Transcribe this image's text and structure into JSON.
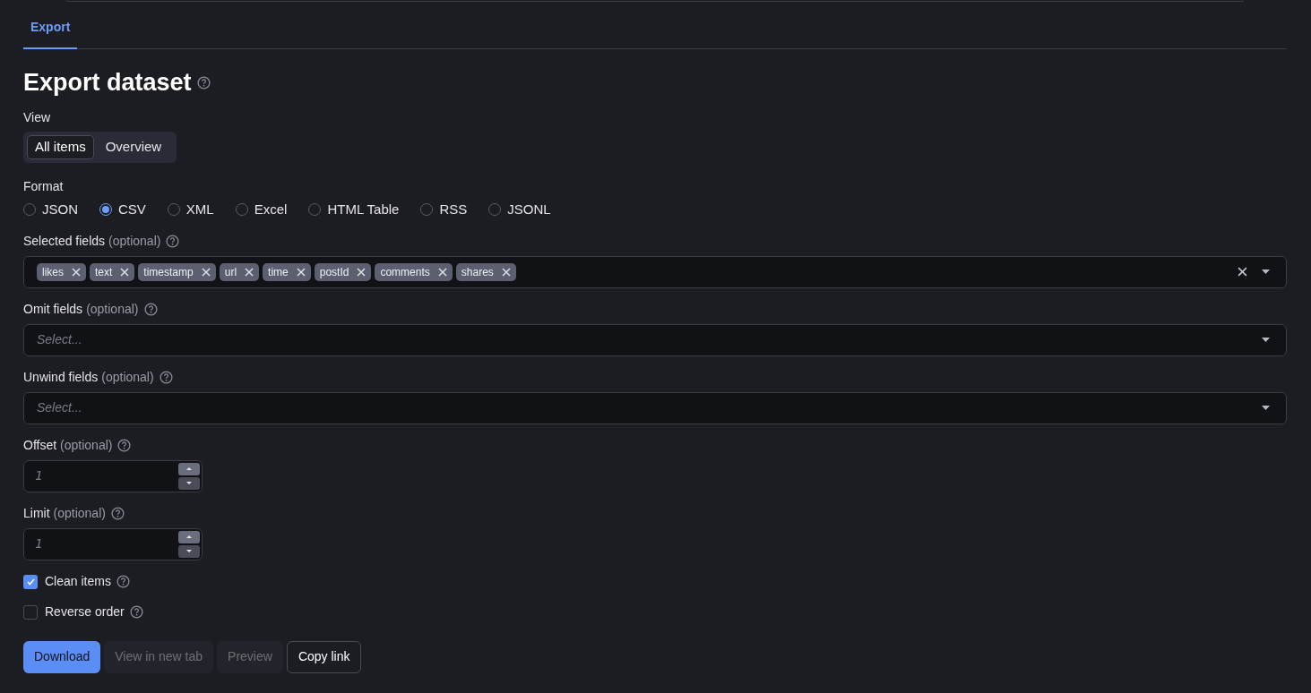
{
  "tabs": [
    {
      "label": "Export",
      "selected": true
    }
  ],
  "title": "Export dataset",
  "view": {
    "label": "View",
    "options": [
      {
        "label": "All items",
        "selected": true
      },
      {
        "label": "Overview",
        "selected": false
      }
    ]
  },
  "format": {
    "label": "Format",
    "options": [
      {
        "label": "JSON",
        "selected": false
      },
      {
        "label": "CSV",
        "selected": true
      },
      {
        "label": "XML",
        "selected": false
      },
      {
        "label": "Excel",
        "selected": false
      },
      {
        "label": "HTML Table",
        "selected": false
      },
      {
        "label": "RSS",
        "selected": false
      },
      {
        "label": "JSONL",
        "selected": false
      }
    ]
  },
  "select_fields": [
    {
      "label": "Selected fields",
      "hint": "(optional)",
      "tags": [
        "likes",
        "text",
        "timestamp",
        "url",
        "time",
        "postId",
        "comments",
        "shares"
      ]
    },
    {
      "label": "Omit fields",
      "hint": "(optional)",
      "placeholder": "Select..."
    },
    {
      "label": "Unwind fields",
      "hint": "(optional)",
      "placeholder": "Select..."
    }
  ],
  "number_fields": [
    {
      "label": "Offset",
      "hint": "(optional)",
      "placeholder": "1"
    },
    {
      "label": "Limit",
      "hint": "(optional)",
      "placeholder": "1"
    }
  ],
  "checkboxes": [
    {
      "label": "Clean items",
      "checked": true
    },
    {
      "label": "Reverse order",
      "checked": false
    }
  ],
  "buttons": [
    {
      "label": "Download",
      "kind": "primary",
      "disabled": false
    },
    {
      "label": "View in new tab",
      "kind": "secondary",
      "disabled": true
    },
    {
      "label": "Preview",
      "kind": "secondary",
      "disabled": true
    },
    {
      "label": "Copy link",
      "kind": "outline",
      "disabled": false
    }
  ]
}
